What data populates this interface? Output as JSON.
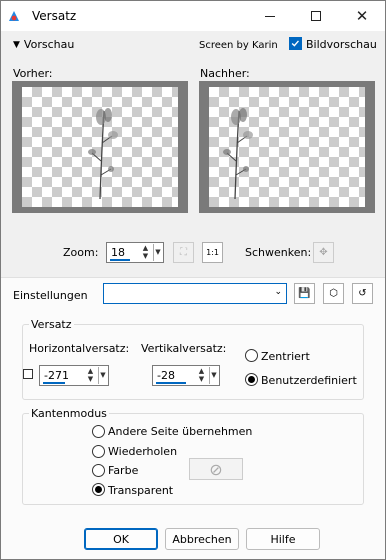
{
  "window": {
    "title": "Versatz",
    "accent": "#0067c0"
  },
  "preview_section": {
    "toggle_label": "Vorschau",
    "credit": "Screen by Karin",
    "image_preview_label": "Bildvorschau",
    "image_preview_checked": true,
    "before_label": "Vorher:",
    "after_label": "Nachher:",
    "zoom_label": "Zoom:",
    "zoom_value": "18",
    "pan_label": "Schwenken:"
  },
  "settings": {
    "label": "Einstellungen",
    "value": ""
  },
  "offset_group": {
    "title": "Versatz",
    "horizontal_label": "Horizontalversatz:",
    "horizontal_value": "-271",
    "vertical_label": "Vertikalversatz:",
    "vertical_value": "-28",
    "centered_label": "Zentriert",
    "user_defined_label": "Benutzerdefiniert",
    "selected": "Benutzerdefiniert"
  },
  "edge_mode_group": {
    "title": "Kantenmodus",
    "options": [
      "Andere Seite übernehmen",
      "Wiederholen",
      "Farbe",
      "Transparent"
    ],
    "selected": "Transparent"
  },
  "buttons": {
    "ok": "OK",
    "cancel": "Abbrechen",
    "help": "Hilfe"
  }
}
